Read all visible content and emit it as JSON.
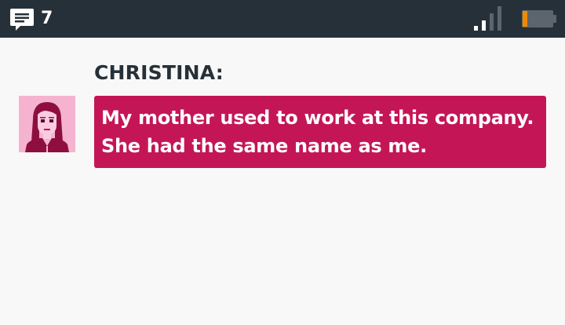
{
  "status_bar": {
    "message_count": "7",
    "icons": {
      "messages": "chat-bubble-icon",
      "signal": "signal-strength-icon",
      "battery": "battery-low-icon"
    },
    "colors": {
      "background": "#263038",
      "battery_level": "#f08a00"
    },
    "signal_bars_active": 2,
    "signal_bars_total": 4,
    "battery_level": 0.15
  },
  "dialogue": {
    "speaker": "CHRISTINA:",
    "message_lines": [
      "My mother used to work at this company.",
      "She had the same name as me."
    ],
    "avatar": "christina-portrait-icon",
    "colors": {
      "bubble": "#c41656",
      "text": "#ffffff",
      "speaker": "#263038"
    }
  }
}
